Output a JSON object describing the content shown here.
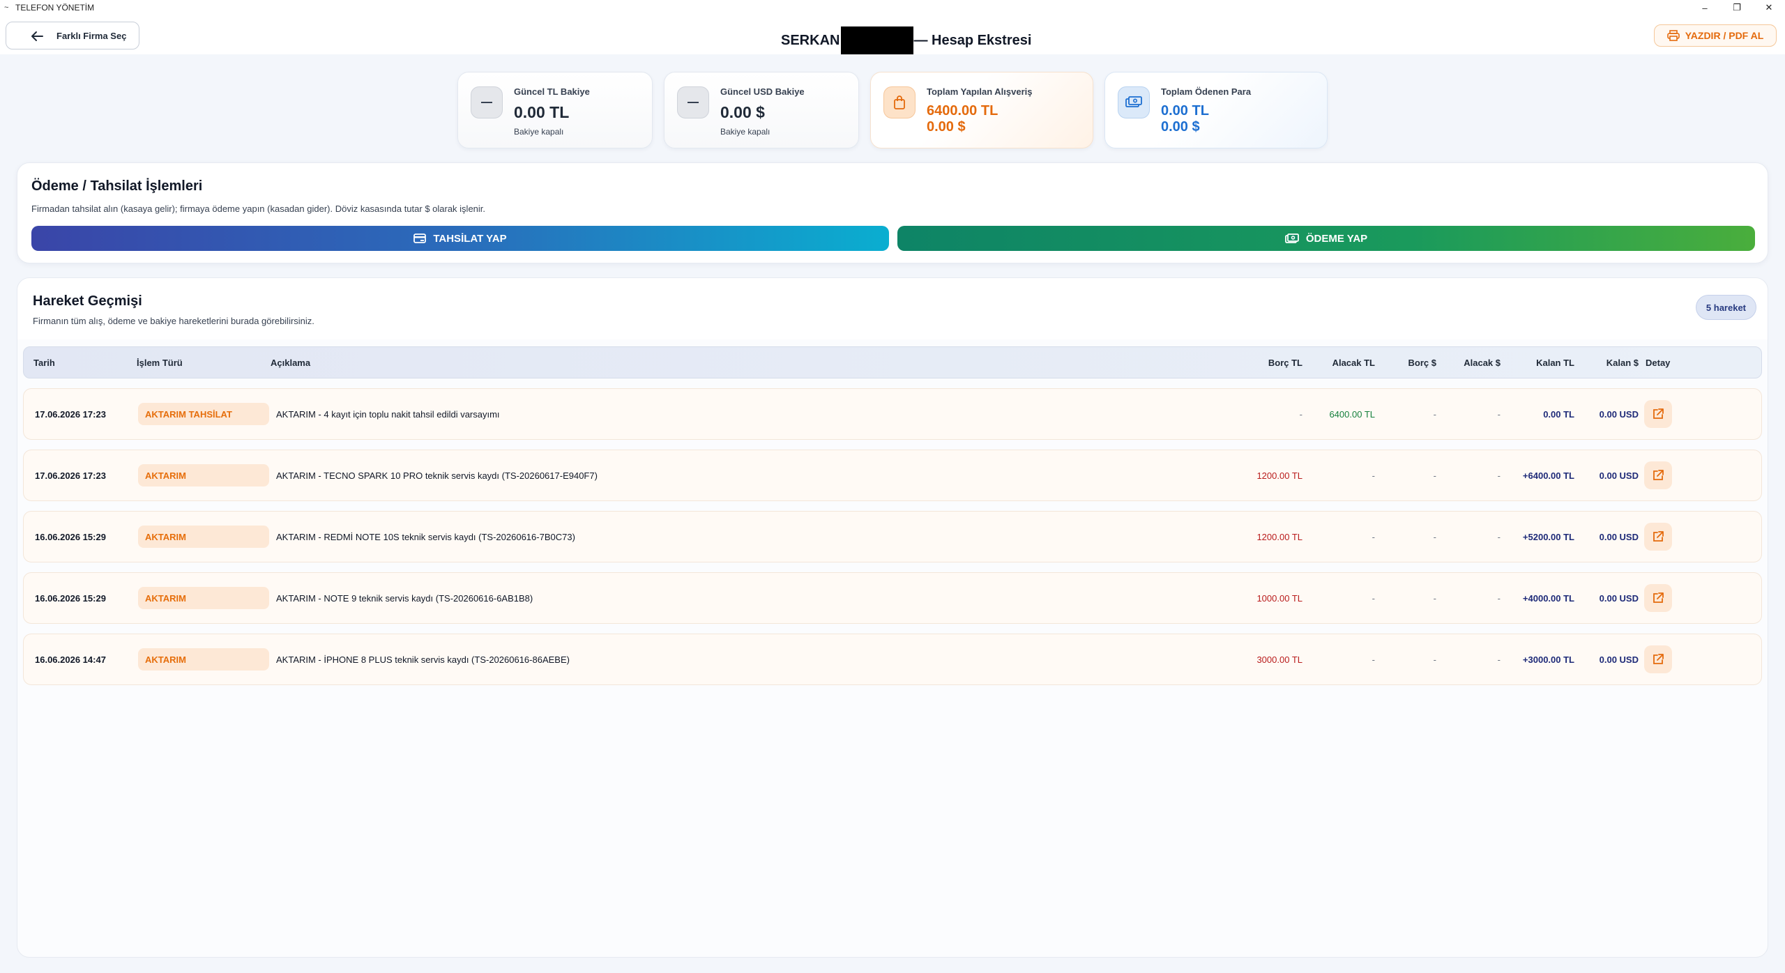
{
  "window": {
    "title": "TELEFON YÖNETİM",
    "controls": [
      "–",
      "❐",
      "✕"
    ]
  },
  "header": {
    "back_label": "Farklı Firma Seç",
    "title_prefix": "SERKAN",
    "title_suffix": "— Hesap Ekstresi",
    "print_label": "YAZDIR / PDF AL"
  },
  "cards": [
    {
      "label": "Güncel TL Bakiye",
      "value": "0.00 TL",
      "sub": "Bakiye kapalı",
      "icon": "minus-icon"
    },
    {
      "label": "Güncel USD Bakiye",
      "value": "0.00 $",
      "sub": "Bakiye kapalı",
      "icon": "minus-icon"
    },
    {
      "label": "Toplam Yapılan Alışveriş",
      "value_tl": "6400.00 TL",
      "value_usd": "0.00 $",
      "icon": "shopping-bag-icon",
      "color": "#e46a0c"
    },
    {
      "label": "Toplam Ödenen Para",
      "value_tl": "0.00 TL",
      "value_usd": "0.00 $",
      "icon": "money-icon",
      "color": "#1d6fd1"
    }
  ],
  "payment": {
    "title": "Ödeme / Tahsilat İşlemleri",
    "desc": "Firmadan tahsilat alın (kasaya gelir); firmaya ödeme yapın (kasadan gider). Döviz kasasında tutar $ olarak işlenir.",
    "tahsilat_label": "TAHSİLAT YAP",
    "odeme_label": "ÖDEME YAP"
  },
  "history": {
    "title": "Hareket Geçmişi",
    "desc": "Firmanın tüm alış, ödeme ve bakiye hareketlerini burada görebilirsiniz.",
    "count": "5 hareket",
    "columns": [
      "Tarih",
      "İşlem Türü",
      "Açıklama",
      "Borç TL",
      "Alacak TL",
      "Borç $",
      "Alacak $",
      "Kalan TL",
      "Kalan $",
      "Detay"
    ],
    "rows": [
      {
        "date": "17.06.2026 17:23",
        "type": "AKTARIM TAHSİLAT",
        "desc": "AKTARIM - 4 kayıt için toplu nakit tahsil edildi varsayımı",
        "borc_tl": "-",
        "alacak_tl": "6400.00 TL",
        "borc_usd": "-",
        "alacak_usd": "-",
        "kalan_tl": "0.00 TL",
        "kalan_usd": "0.00 USD"
      },
      {
        "date": "17.06.2026 17:23",
        "type": "AKTARIM",
        "desc": "AKTARIM - TECNO SPARK 10 PRO teknik servis kaydı (TS-20260617-E940F7)",
        "borc_tl": "1200.00 TL",
        "alacak_tl": "-",
        "borc_usd": "-",
        "alacak_usd": "-",
        "kalan_tl": "+6400.00 TL",
        "kalan_usd": "0.00 USD"
      },
      {
        "date": "16.06.2026 15:29",
        "type": "AKTARIM",
        "desc": "AKTARIM - REDMİ NOTE 10S teknik servis kaydı (TS-20260616-7B0C73)",
        "borc_tl": "1200.00 TL",
        "alacak_tl": "-",
        "borc_usd": "-",
        "alacak_usd": "-",
        "kalan_tl": "+5200.00 TL",
        "kalan_usd": "0.00 USD"
      },
      {
        "date": "16.06.2026 15:29",
        "type": "AKTARIM",
        "desc": "AKTARIM - NOTE 9 teknik servis kaydı (TS-20260616-6AB1B8)",
        "borc_tl": "1000.00 TL",
        "alacak_tl": "-",
        "borc_usd": "-",
        "alacak_usd": "-",
        "kalan_tl": "+4000.00 TL",
        "kalan_usd": "0.00 USD"
      },
      {
        "date": "16.06.2026 14:47",
        "type": "AKTARIM",
        "desc": "AKTARIM - İPHONE 8 PLUS teknik servis kaydı (TS-20260616-86AEBE)",
        "borc_tl": "3000.00 TL",
        "alacak_tl": "-",
        "borc_usd": "-",
        "alacak_usd": "-",
        "kalan_tl": "+3000.00 TL",
        "kalan_usd": "0.00 USD"
      }
    ]
  }
}
